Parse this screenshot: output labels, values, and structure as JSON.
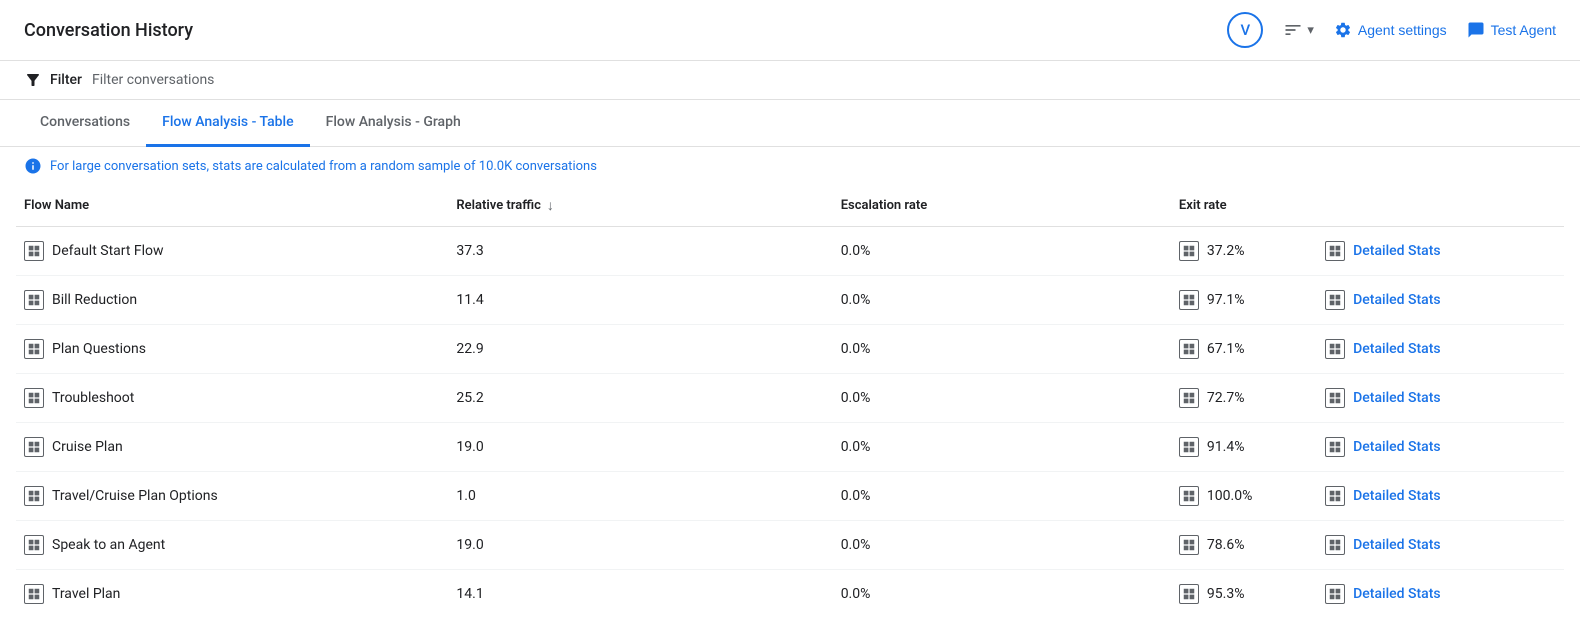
{
  "header": {
    "title": "Conversation History",
    "avatar_label": "V",
    "agent_settings_label": "Agent settings",
    "test_agent_label": "Test Agent"
  },
  "filter_bar": {
    "filter_label": "Filter",
    "filter_placeholder": "Filter conversations"
  },
  "tabs": [
    {
      "id": "conversations",
      "label": "Conversations",
      "active": false
    },
    {
      "id": "flow-table",
      "label": "Flow Analysis - Table",
      "active": true
    },
    {
      "id": "flow-graph",
      "label": "Flow Analysis - Graph",
      "active": false
    }
  ],
  "info_notice": "For large conversation sets, stats are calculated from a random sample of 10.0K conversations",
  "table": {
    "columns": [
      {
        "id": "flow-name",
        "label": "Flow Name"
      },
      {
        "id": "relative-traffic",
        "label": "Relative traffic",
        "sortable": true
      },
      {
        "id": "escalation-rate",
        "label": "Escalation rate"
      },
      {
        "id": "exit-rate",
        "label": "Exit rate"
      },
      {
        "id": "actions",
        "label": ""
      }
    ],
    "rows": [
      {
        "flow_name": "Default Start Flow",
        "relative_traffic": "37.3",
        "escalation_rate": "0.0%",
        "exit_rate": "37.2%",
        "link_label": "Detailed Stats"
      },
      {
        "flow_name": "Bill Reduction",
        "relative_traffic": "11.4",
        "escalation_rate": "0.0%",
        "exit_rate": "97.1%",
        "link_label": "Detailed Stats"
      },
      {
        "flow_name": "Plan Questions",
        "relative_traffic": "22.9",
        "escalation_rate": "0.0%",
        "exit_rate": "67.1%",
        "link_label": "Detailed Stats"
      },
      {
        "flow_name": "Troubleshoot",
        "relative_traffic": "25.2",
        "escalation_rate": "0.0%",
        "exit_rate": "72.7%",
        "link_label": "Detailed Stats"
      },
      {
        "flow_name": "Cruise Plan",
        "relative_traffic": "19.0",
        "escalation_rate": "0.0%",
        "exit_rate": "91.4%",
        "link_label": "Detailed Stats"
      },
      {
        "flow_name": "Travel/Cruise Plan Options",
        "relative_traffic": "1.0",
        "escalation_rate": "0.0%",
        "exit_rate": "100.0%",
        "link_label": "Detailed Stats"
      },
      {
        "flow_name": "Speak to an Agent",
        "relative_traffic": "19.0",
        "escalation_rate": "0.0%",
        "exit_rate": "78.6%",
        "link_label": "Detailed Stats"
      },
      {
        "flow_name": "Travel Plan",
        "relative_traffic": "14.1",
        "escalation_rate": "0.0%",
        "exit_rate": "95.3%",
        "link_label": "Detailed Stats"
      }
    ]
  }
}
